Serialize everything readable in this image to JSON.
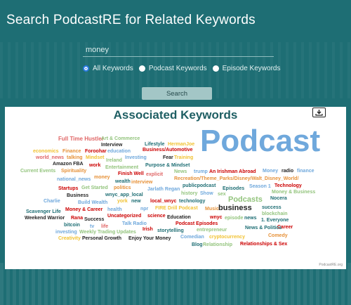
{
  "header": {
    "title": "Search PodcastRE for Related Keywords"
  },
  "search": {
    "value": "money"
  },
  "radios": [
    {
      "label": "All Keywords",
      "checked": true
    },
    {
      "label": "Podcast Keywords",
      "checked": false
    },
    {
      "label": "Episode Keywords",
      "checked": false
    }
  ],
  "search_button": {
    "label": "Search"
  },
  "panel": {
    "title": "Associated Keywords",
    "credit": "PodcastRE.org",
    "download_icon": "download-icon"
  },
  "cloud_words": [
    {
      "text": "Podcast",
      "color": "#6fa8dc"
    },
    {
      "text": "Full Time Hustler",
      "color": "#e06666"
    },
    {
      "text": "Art & Commerce",
      "color": "#93c47d"
    },
    {
      "text": "Interview",
      "color": "#222222"
    },
    {
      "text": "Lifestyle",
      "color": "#1e6e74"
    },
    {
      "text": "HermanJoe",
      "color": "#f1c232"
    },
    {
      "text": "economics",
      "color": "#f1c232"
    },
    {
      "text": "Finance",
      "color": "#e69138"
    },
    {
      "text": "Foroohar",
      "color": "#cc0000"
    },
    {
      "text": "education",
      "color": "#6fa8dc"
    },
    {
      "text": "Business/Automotive",
      "color": "#cc0000"
    },
    {
      "text": "world_news",
      "color": "#e06666"
    },
    {
      "text": "talking",
      "color": "#e69138"
    },
    {
      "text": "Mindset",
      "color": "#f1c232"
    },
    {
      "text": "Ireland",
      "color": "#93c47d"
    },
    {
      "text": "Investing",
      "color": "#6fa8dc"
    },
    {
      "text": "Fear",
      "color": "#222222"
    },
    {
      "text": "Training",
      "color": "#f1c232"
    },
    {
      "text": "Amazon FBA",
      "color": "#222222"
    },
    {
      "text": "work",
      "color": "#cc0000"
    },
    {
      "text": "Entertainment",
      "color": "#93c47d"
    },
    {
      "text": "Purpose & Mindset",
      "color": "#1e6e74"
    },
    {
      "text": "Current Events",
      "color": "#93c47d"
    },
    {
      "text": "Spirituality",
      "color": "#e69138"
    },
    {
      "text": "Finish Well",
      "color": "#cc0000"
    },
    {
      "text": "explicit",
      "color": "#e06666"
    },
    {
      "text": "News",
      "color": "#93c47d"
    },
    {
      "text": "trump",
      "color": "#6fa8dc"
    },
    {
      "text": "An Irishman Abroad",
      "color": "#cc0000"
    },
    {
      "text": "Money",
      "color": "#6fa8dc"
    },
    {
      "text": "radio",
      "color": "#222222"
    },
    {
      "text": "finance",
      "color": "#6fa8dc"
    },
    {
      "text": "national_news",
      "color": "#6fa8dc"
    },
    {
      "text": "money",
      "color": "#e69138"
    },
    {
      "text": "wealth",
      "color": "#1e6e74"
    },
    {
      "text": "interview",
      "color": "#e69138"
    },
    {
      "text": "Recreation/Theme_Parks/Disney/Walt_Disney_World/",
      "color": "#e69138"
    },
    {
      "text": "Startups",
      "color": "#cc0000"
    },
    {
      "text": "Get Started",
      "color": "#93c47d"
    },
    {
      "text": "politics",
      "color": "#e69138"
    },
    {
      "text": "Jarlath Regan",
      "color": "#6fa8dc"
    },
    {
      "text": "publicpodcast",
      "color": "#1e6e74"
    },
    {
      "text": "Season 1",
      "color": "#6fa8dc"
    },
    {
      "text": "Technology",
      "color": "#cc0000"
    },
    {
      "text": "Business",
      "color": "#222222"
    },
    {
      "text": "wnyc_app_local",
      "color": "#1e6e74"
    },
    {
      "text": "history",
      "color": "#93c47d"
    },
    {
      "text": "Show",
      "color": "#6fa8dc"
    },
    {
      "text": "sex",
      "color": "#93c47d"
    },
    {
      "text": "Episodes",
      "color": "#1e6e74"
    },
    {
      "text": "Money & Business",
      "color": "#93c47d"
    },
    {
      "text": "Charlie",
      "color": "#6fa8dc"
    },
    {
      "text": "Build Wealth",
      "color": "#6fa8dc"
    },
    {
      "text": "york",
      "color": "#f1c232"
    },
    {
      "text": "new",
      "color": "#1e6e74"
    },
    {
      "text": "local_wnyc",
      "color": "#cc0000"
    },
    {
      "text": "technology",
      "color": "#1e6e74"
    },
    {
      "text": "Podcasts",
      "color": "#93c47d"
    },
    {
      "text": "Nocera",
      "color": "#1e6e74"
    },
    {
      "text": "Scavenger Life",
      "color": "#1e6e74"
    },
    {
      "text": "Money & Career",
      "color": "#cc0000"
    },
    {
      "text": "health",
      "color": "#6fa8dc"
    },
    {
      "text": "npr",
      "color": "#6fa8dc"
    },
    {
      "text": "FIRE Drill Podcast",
      "color": "#f1c232"
    },
    {
      "text": "Music",
      "color": "#e69138"
    },
    {
      "text": "business",
      "color": "#222222"
    },
    {
      "text": "success",
      "color": "#1e6e74"
    },
    {
      "text": "blockchain",
      "color": "#93c47d"
    },
    {
      "text": "Weekend Warrior",
      "color": "#222222"
    },
    {
      "text": "Rana",
      "color": "#cc0000"
    },
    {
      "text": "Success",
      "color": "#222222"
    },
    {
      "text": "Uncategorized",
      "color": "#cc0000"
    },
    {
      "text": "science",
      "color": "#cc0000"
    },
    {
      "text": "Education",
      "color": "#222222"
    },
    {
      "text": "wnyc",
      "color": "#cc0000"
    },
    {
      "text": "episode",
      "color": "#93c47d"
    },
    {
      "text": "news",
      "color": "#1e6e74"
    },
    {
      "text": "1. Everyone",
      "color": "#1e6e74"
    },
    {
      "text": "bitcoin",
      "color": "#1e6e74"
    },
    {
      "text": "tv",
      "color": "#6fa8dc"
    },
    {
      "text": "life",
      "color": "#e06666"
    },
    {
      "text": "Talk Radio",
      "color": "#6fa8dc"
    },
    {
      "text": "Podcast Episodes",
      "color": "#cc0000"
    },
    {
      "text": "Career",
      "color": "#cc0000"
    },
    {
      "text": "News & Politics",
      "color": "#1e6e74"
    },
    {
      "text": "investing",
      "color": "#6fa8dc"
    },
    {
      "text": "Weekly Trading Updates",
      "color": "#93c47d"
    },
    {
      "text": "Irish",
      "color": "#cc0000"
    },
    {
      "text": "storytelling",
      "color": "#1e6e74"
    },
    {
      "text": "entrepreneur",
      "color": "#93c47d"
    },
    {
      "text": "Creativity",
      "color": "#f1c232"
    },
    {
      "text": "Personal Growth",
      "color": "#222222"
    },
    {
      "text": "Enjoy Your Money",
      "color": "#222222"
    },
    {
      "text": "Comedian",
      "color": "#6fa8dc"
    },
    {
      "text": "cryptocurrency",
      "color": "#f1c232"
    },
    {
      "text": "Comedy",
      "color": "#e69138"
    },
    {
      "text": "Blog",
      "color": "#1e6e74"
    },
    {
      "text": "Relationship",
      "color": "#93c47d"
    },
    {
      "text": "Relationships & Sex",
      "color": "#cc0000"
    }
  ]
}
